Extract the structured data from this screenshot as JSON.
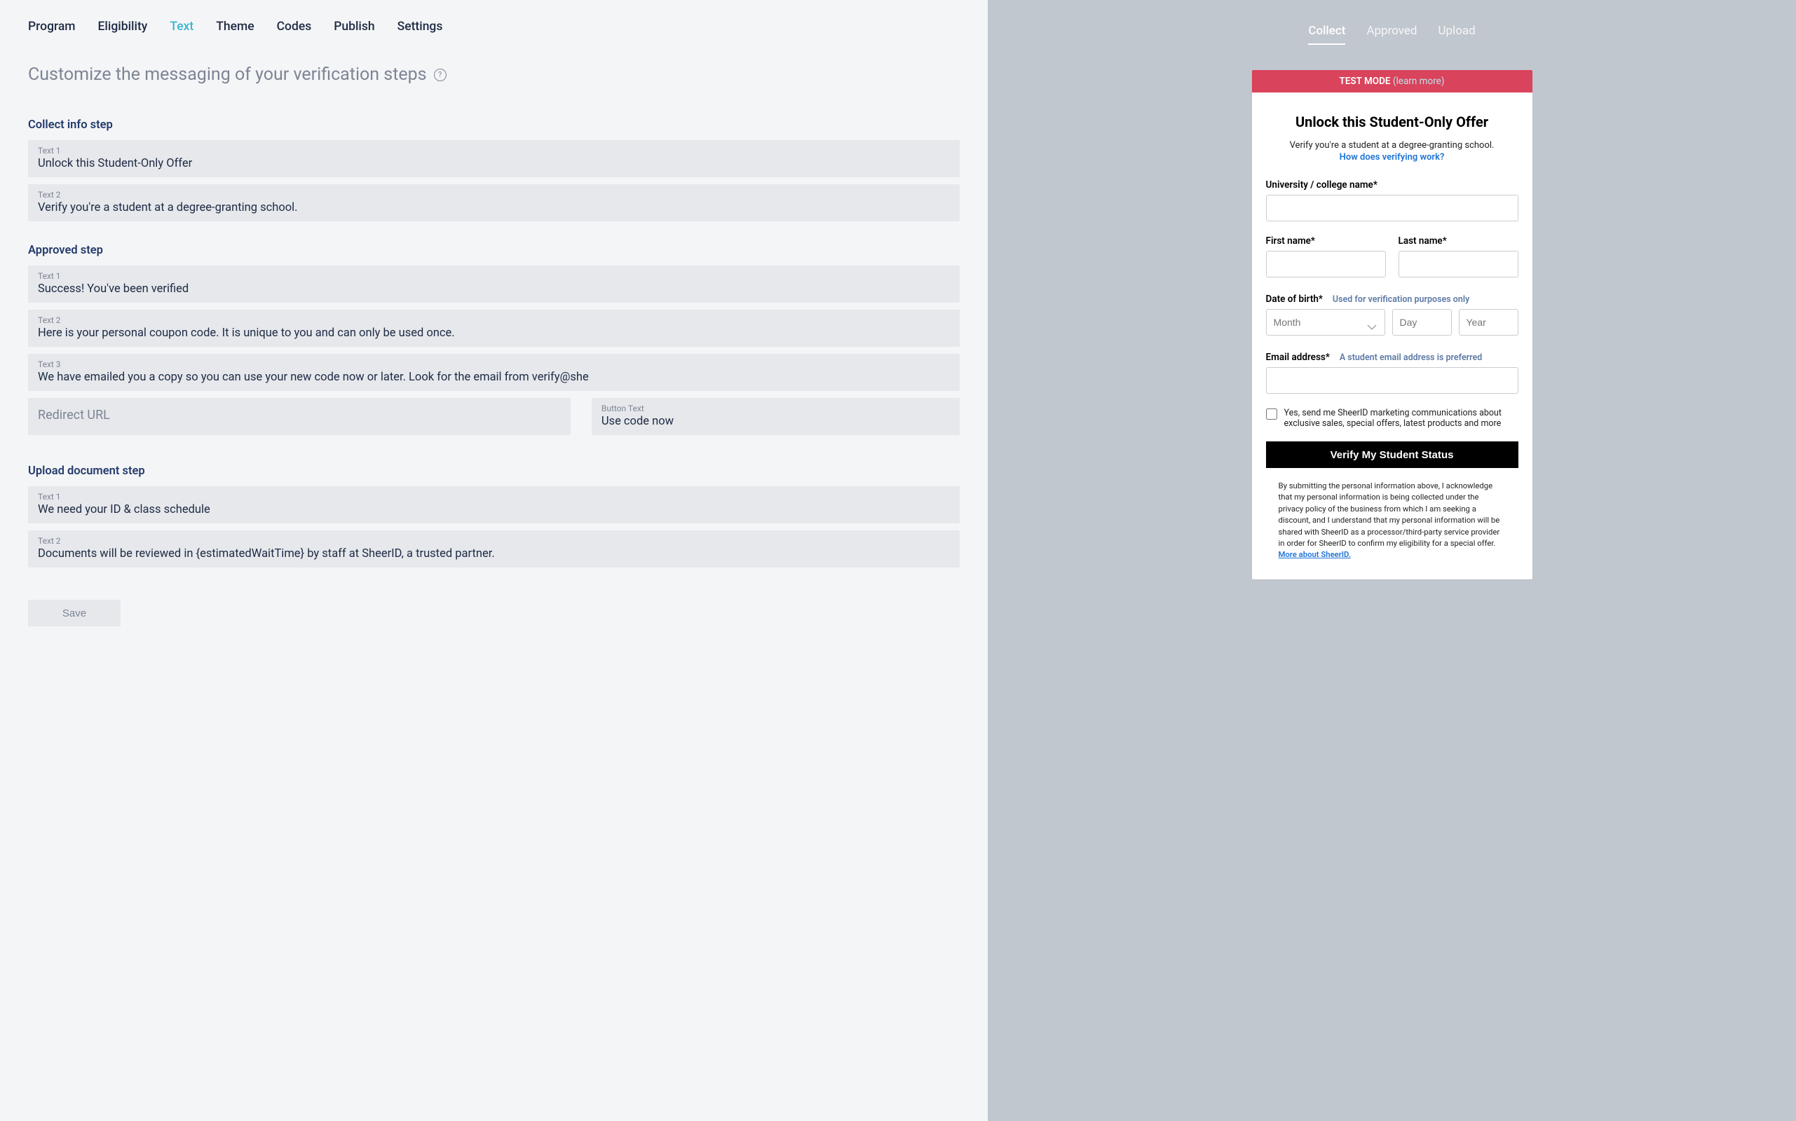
{
  "nav": {
    "tabs": [
      "Program",
      "Eligibility",
      "Text",
      "Theme",
      "Codes",
      "Publish",
      "Settings"
    ],
    "active_index": 2
  },
  "heading": "Customize the messaging of your verification steps",
  "sections": {
    "collect": {
      "title": "Collect info step",
      "text1_label": "Text 1",
      "text1": "Unlock this Student-Only Offer",
      "text2_label": "Text 2",
      "text2": "Verify you're a student at a degree-granting school."
    },
    "approved": {
      "title": "Approved step",
      "text1_label": "Text 1",
      "text1": "Success! You've been verified",
      "text2_label": "Text 2",
      "text2": "Here is your personal coupon code. It is unique to you and can only be used once.",
      "text3_label": "Text 3",
      "text3": "We have emailed you a copy so you can use your new code now or later. Look for the email from verify@she",
      "redirect_placeholder": "Redirect URL",
      "button_text_label": "Button Text",
      "button_text": "Use code now"
    },
    "upload": {
      "title": "Upload document step",
      "text1_label": "Text 1",
      "text1": "We need your ID & class schedule",
      "text2_label": "Text 2",
      "text2": "Documents will be reviewed in {estimatedWaitTime} by staff at SheerID, a trusted partner."
    }
  },
  "save_label": "Save",
  "preview": {
    "tabs": [
      "Collect",
      "Approved",
      "Upload"
    ],
    "active_index": 0,
    "banner": {
      "text": "TEST MODE",
      "link": "(learn more)"
    },
    "title": "Unlock this Student-Only Offer",
    "subtitle": "Verify you're a student at a degree-granting school.",
    "how_link": "How does verifying work?",
    "fields": {
      "university_label": "University / college name*",
      "first_name_label": "First name*",
      "last_name_label": "Last name*",
      "dob_label": "Date of birth*",
      "dob_helper": "Used for verification purposes only",
      "month_placeholder": "Month",
      "day_placeholder": "Day",
      "year_placeholder": "Year",
      "email_label": "Email address*",
      "email_helper": "A student email address is preferred"
    },
    "consent_text": "Yes, send me SheerID marketing communications about exclusive sales, special offers, latest products and more",
    "verify_button": "Verify My Student Status",
    "disclaimer": "By submitting the personal information above, I acknowledge that my personal information is being collected under the privacy policy of the business from which I am seeking a discount, and I understand that my personal information will be shared with SheerID as a processor/third-party service provider in order for SheerID to confirm my eligibility for a special offer.",
    "disclaimer_link": "More about SheerID."
  }
}
